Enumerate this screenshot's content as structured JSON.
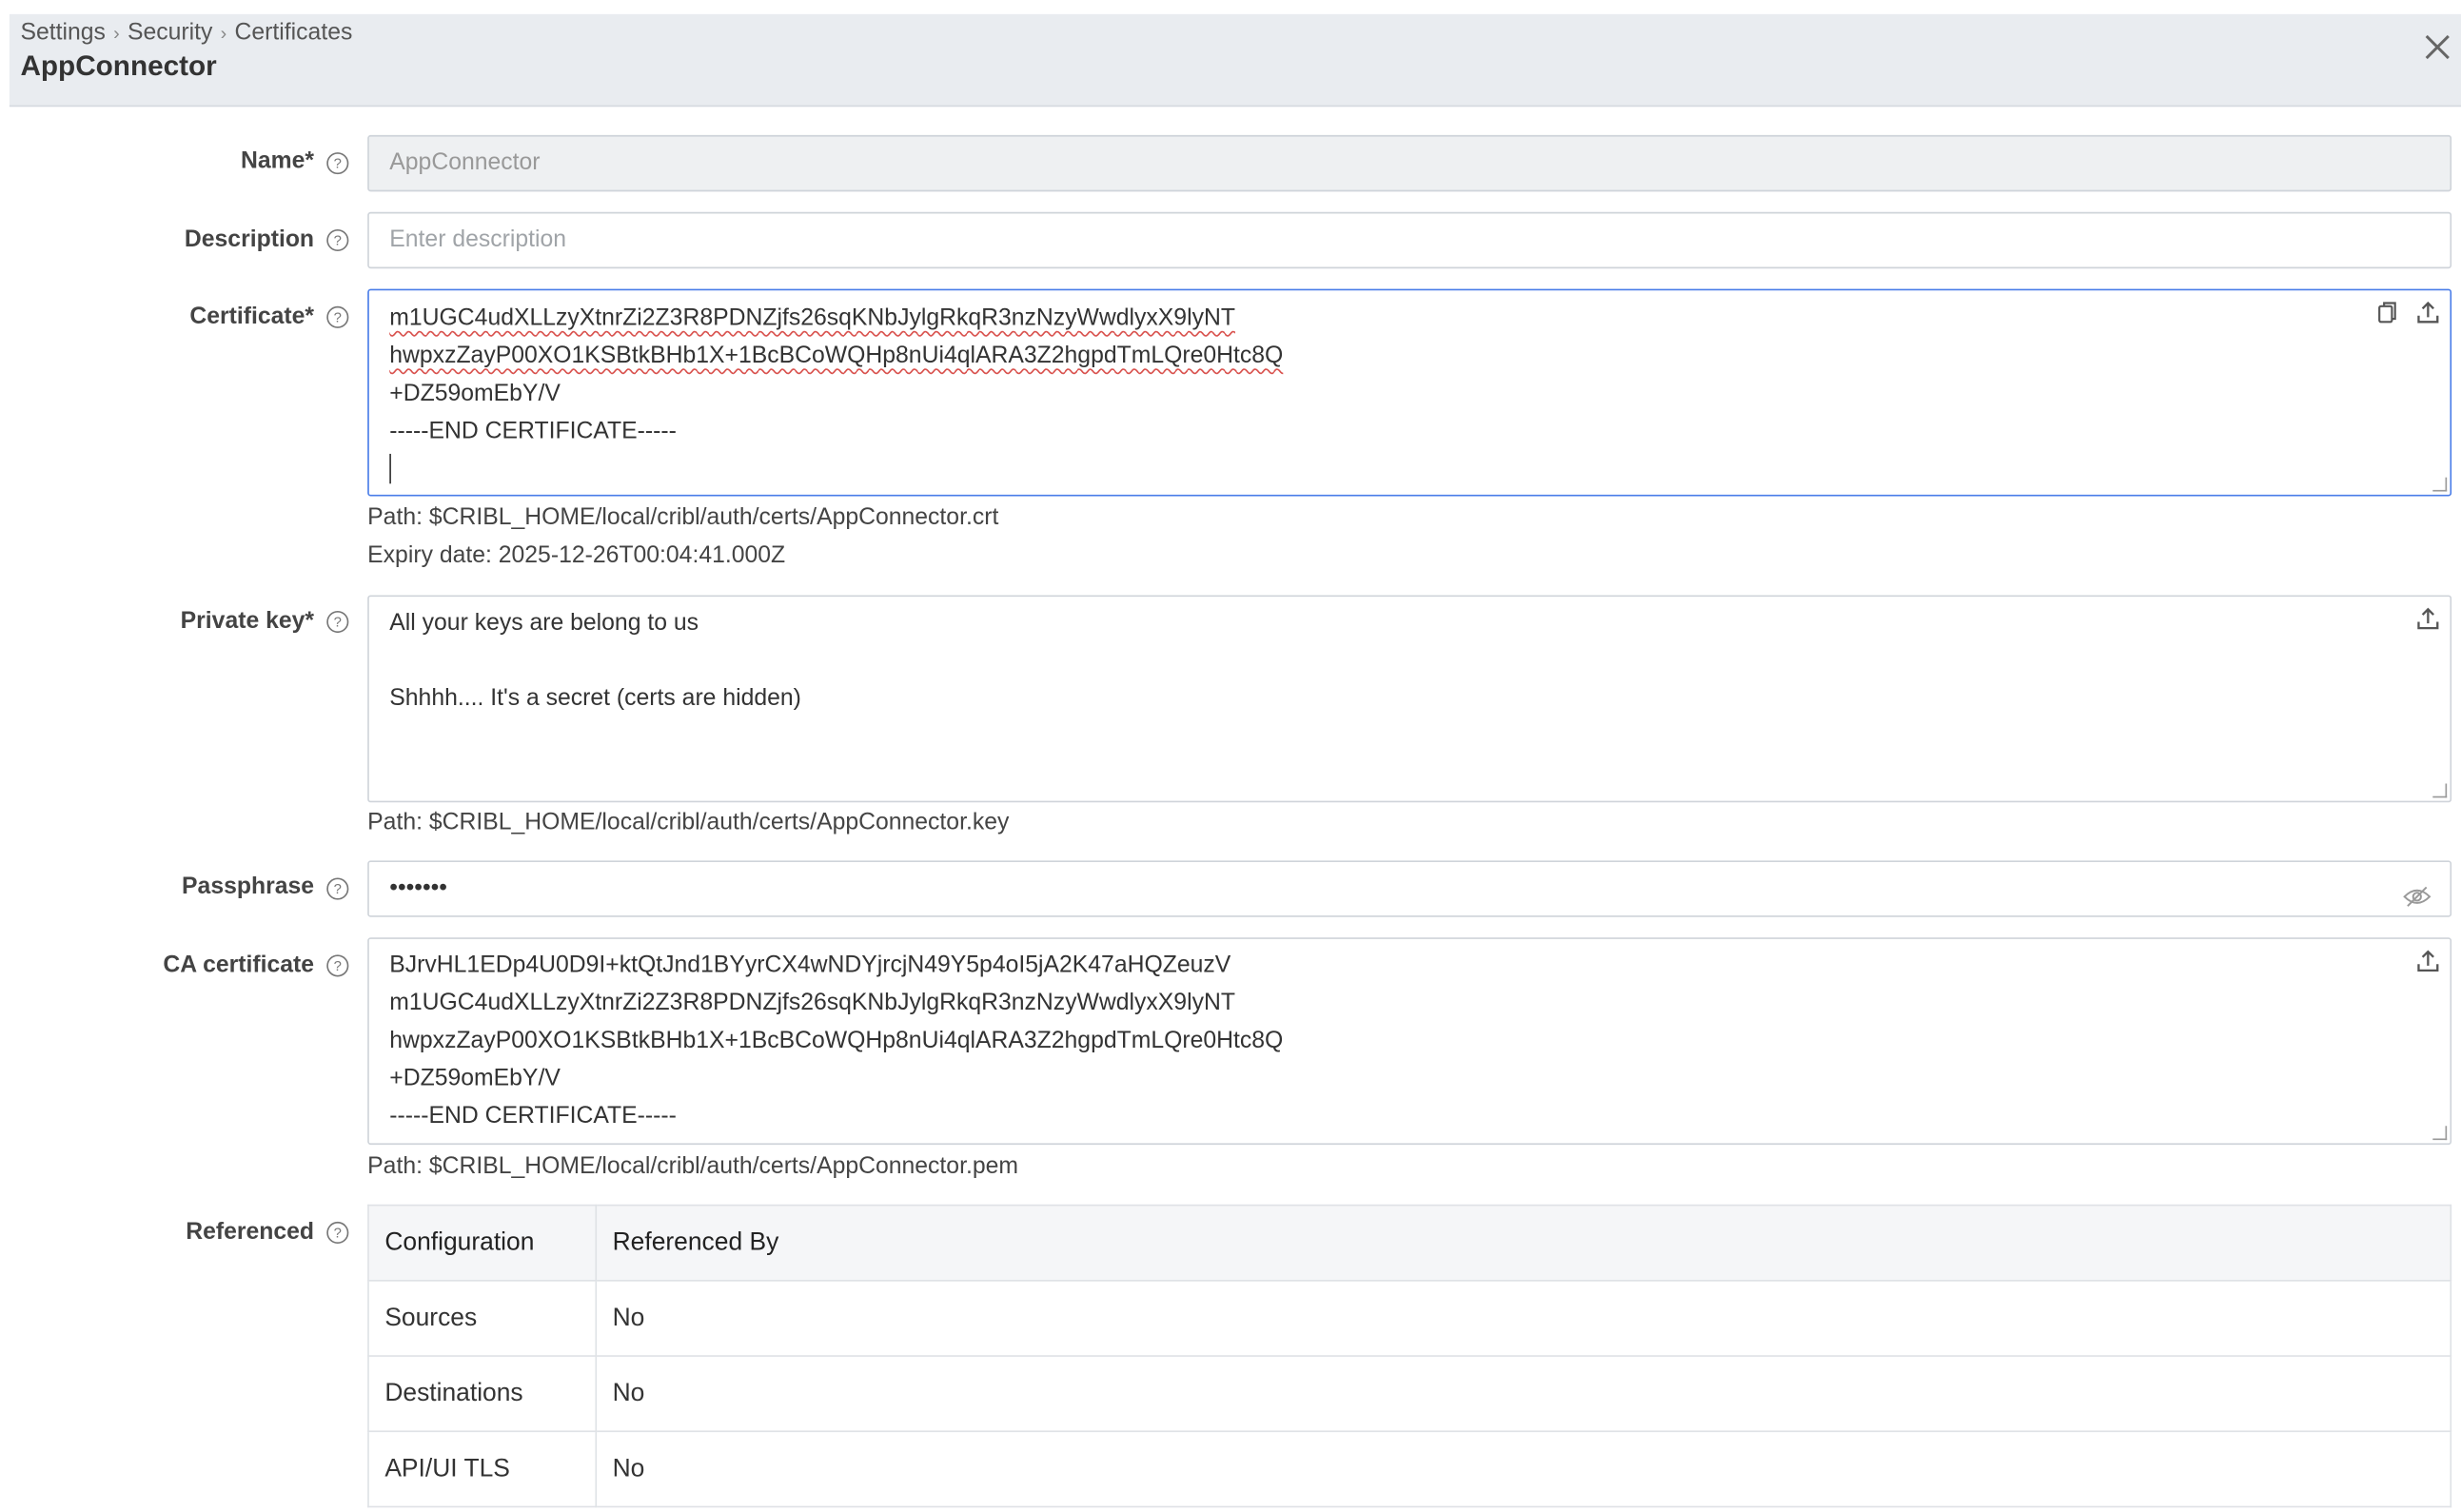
{
  "header": {
    "breadcrumb": [
      "Settings",
      "Security",
      "Certificates"
    ],
    "breadcrumb_sep": "›",
    "title": "AppConnector",
    "close_icon": "close-icon"
  },
  "form": {
    "name": {
      "label": "Name*",
      "value": "AppConnector"
    },
    "description": {
      "label": "Description",
      "placeholder": "Enter description"
    },
    "certificate": {
      "label": "Certificate*",
      "lines": [
        "m1UGC4udXLLzyXtnrZi2Z3R8PDNZjfs26sqKNbJylgRkqR3nzNzyWwdlyxX9lyNT",
        "hwpxzZayP00XO1KSBtkBHb1X+1BcBCoWQHp8nUi4qlARA3Z2hgpdTmLQre0Htc8Q",
        "+DZ59omEbY/V",
        "-----END CERTIFICATE-----"
      ],
      "path": "Path: $CRIBL_HOME/local/cribl/auth/certs/AppConnector.crt",
      "expiry": "Expiry date: 2025-12-26T00:04:41.000Z"
    },
    "private_key": {
      "label": "Private key*",
      "lines": [
        "All your keys are belong to us",
        "",
        "Shhhh.... It's a secret (certs are hidden)"
      ],
      "path": "Path: $CRIBL_HOME/local/cribl/auth/certs/AppConnector.key"
    },
    "passphrase": {
      "label": "Passphrase",
      "value": "•••••••"
    },
    "ca_certificate": {
      "label": "CA certificate",
      "lines": [
        "BJrvHL1EDp4U0D9I+ktQtJnd1BYyrCX4wNDYjrcjN49Y5p4oI5jA2K47aHQZeuzV",
        "m1UGC4udXLLzyXtnrZi2Z3R8PDNZjfs26sqKNbJylgRkqR3nzNzyWwdlyxX9lyNT",
        "hwpxzZayP00XO1KSBtkBHb1X+1BcBCoWQHp8nUi4qlARA3Z2hgpdTmLQre0Htc8Q",
        "+DZ59omEbY/V",
        "-----END CERTIFICATE-----"
      ],
      "path": "Path: $CRIBL_HOME/local/cribl/auth/certs/AppConnector.pem"
    },
    "referenced": {
      "label": "Referenced",
      "columns": [
        "Configuration",
        "Referenced By"
      ],
      "rows": [
        [
          "Sources",
          "No"
        ],
        [
          "Destinations",
          "No"
        ],
        [
          "API/UI TLS",
          "No"
        ]
      ]
    },
    "help_glyph": "?"
  }
}
